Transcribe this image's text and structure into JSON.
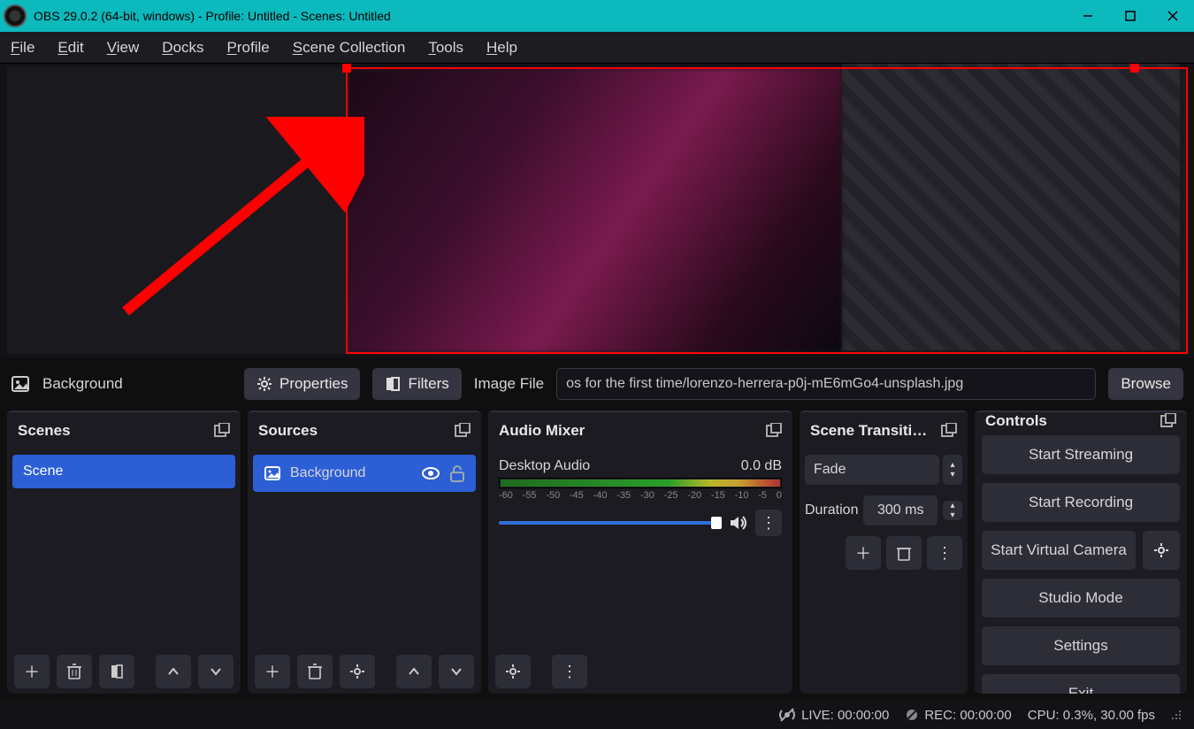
{
  "window_title": "OBS 29.0.2 (64-bit, windows) - Profile: Untitled - Scenes: Untitled",
  "menus": {
    "file": "File",
    "edit": "Edit",
    "view": "View",
    "docks": "Docks",
    "profile": "Profile",
    "scenecol": "Scene Collection",
    "tools": "Tools",
    "help": "Help"
  },
  "context": {
    "source_name": "Background",
    "properties": "Properties",
    "filters": "Filters",
    "field_label": "Image File",
    "path": "os for the first time/lorenzo-herrera-p0j-mE6mGo4-unsplash.jpg",
    "browse": "Browse"
  },
  "panels": {
    "scenes": {
      "title": "Scenes",
      "items": [
        "Scene"
      ]
    },
    "sources": {
      "title": "Sources",
      "items": [
        "Background"
      ]
    },
    "mixer": {
      "title": "Audio Mixer",
      "track": "Desktop Audio",
      "level": "0.0 dB",
      "ticks": [
        "-60",
        "-55",
        "-50",
        "-45",
        "-40",
        "-35",
        "-30",
        "-25",
        "-20",
        "-15",
        "-10",
        "-5",
        "0"
      ]
    },
    "trans": {
      "title": "Scene Transiti…",
      "selected": "Fade",
      "duration_label": "Duration",
      "duration": "300 ms"
    },
    "controls": {
      "title": "Controls",
      "start_stream": "Start Streaming",
      "start_rec": "Start Recording",
      "virtual_cam": "Start Virtual Camera",
      "studio": "Studio Mode",
      "settings": "Settings",
      "exit": "Exit"
    }
  },
  "status": {
    "live": "LIVE: 00:00:00",
    "rec": "REC: 00:00:00",
    "cpu": "CPU: 0.3%, 30.00 fps"
  }
}
